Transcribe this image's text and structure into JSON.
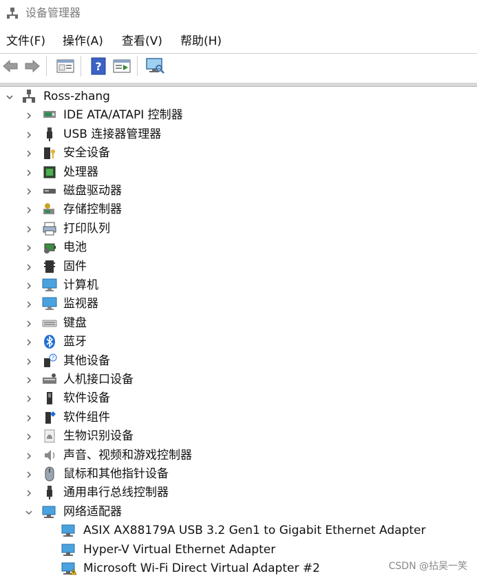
{
  "window": {
    "title": "设备管理器"
  },
  "menu": [
    "文件(F)",
    "操作(A)",
    "查看(V)",
    "帮助(H)"
  ],
  "toolbar": [
    "back-icon",
    "forward-icon",
    "properties-icon",
    "help-icon",
    "update-driver-icon",
    "scan-hardware-icon"
  ],
  "tree": {
    "root": "Ross-zhang",
    "categories": [
      {
        "label": "IDE ATA/ATAPI 控制器",
        "icon": "ide-controller-icon"
      },
      {
        "label": "USB 连接器管理器",
        "icon": "usb-connector-icon"
      },
      {
        "label": "安全设备",
        "icon": "security-device-icon"
      },
      {
        "label": "处理器",
        "icon": "processor-icon"
      },
      {
        "label": "磁盘驱动器",
        "icon": "disk-drive-icon"
      },
      {
        "label": "存储控制器",
        "icon": "storage-controller-icon"
      },
      {
        "label": "打印队列",
        "icon": "print-queue-icon"
      },
      {
        "label": "电池",
        "icon": "battery-icon"
      },
      {
        "label": "固件",
        "icon": "firmware-icon"
      },
      {
        "label": "计算机",
        "icon": "computer-icon"
      },
      {
        "label": "监视器",
        "icon": "monitor-icon"
      },
      {
        "label": "键盘",
        "icon": "keyboard-icon"
      },
      {
        "label": "蓝牙",
        "icon": "bluetooth-icon"
      },
      {
        "label": "其他设备",
        "icon": "other-devices-icon"
      },
      {
        "label": "人机接口设备",
        "icon": "hid-icon"
      },
      {
        "label": "软件设备",
        "icon": "software-device-icon"
      },
      {
        "label": "软件组件",
        "icon": "software-component-icon"
      },
      {
        "label": "生物识别设备",
        "icon": "biometric-icon"
      },
      {
        "label": "声音、视频和游戏控制器",
        "icon": "sound-icon"
      },
      {
        "label": "鼠标和其他指针设备",
        "icon": "mouse-icon"
      },
      {
        "label": "通用串行总线控制器",
        "icon": "usb-controller-icon"
      },
      {
        "label": "网络适配器",
        "icon": "network-adapter-icon"
      }
    ],
    "network_adapters": [
      "ASIX AX88179A USB 3.2 Gen1 to Gigabit Ethernet Adapter",
      "Hyper-V Virtual Ethernet Adapter",
      "Microsoft Wi-Fi Direct Virtual Adapter #2"
    ]
  },
  "watermark": "CSDN @拈吴一笑"
}
